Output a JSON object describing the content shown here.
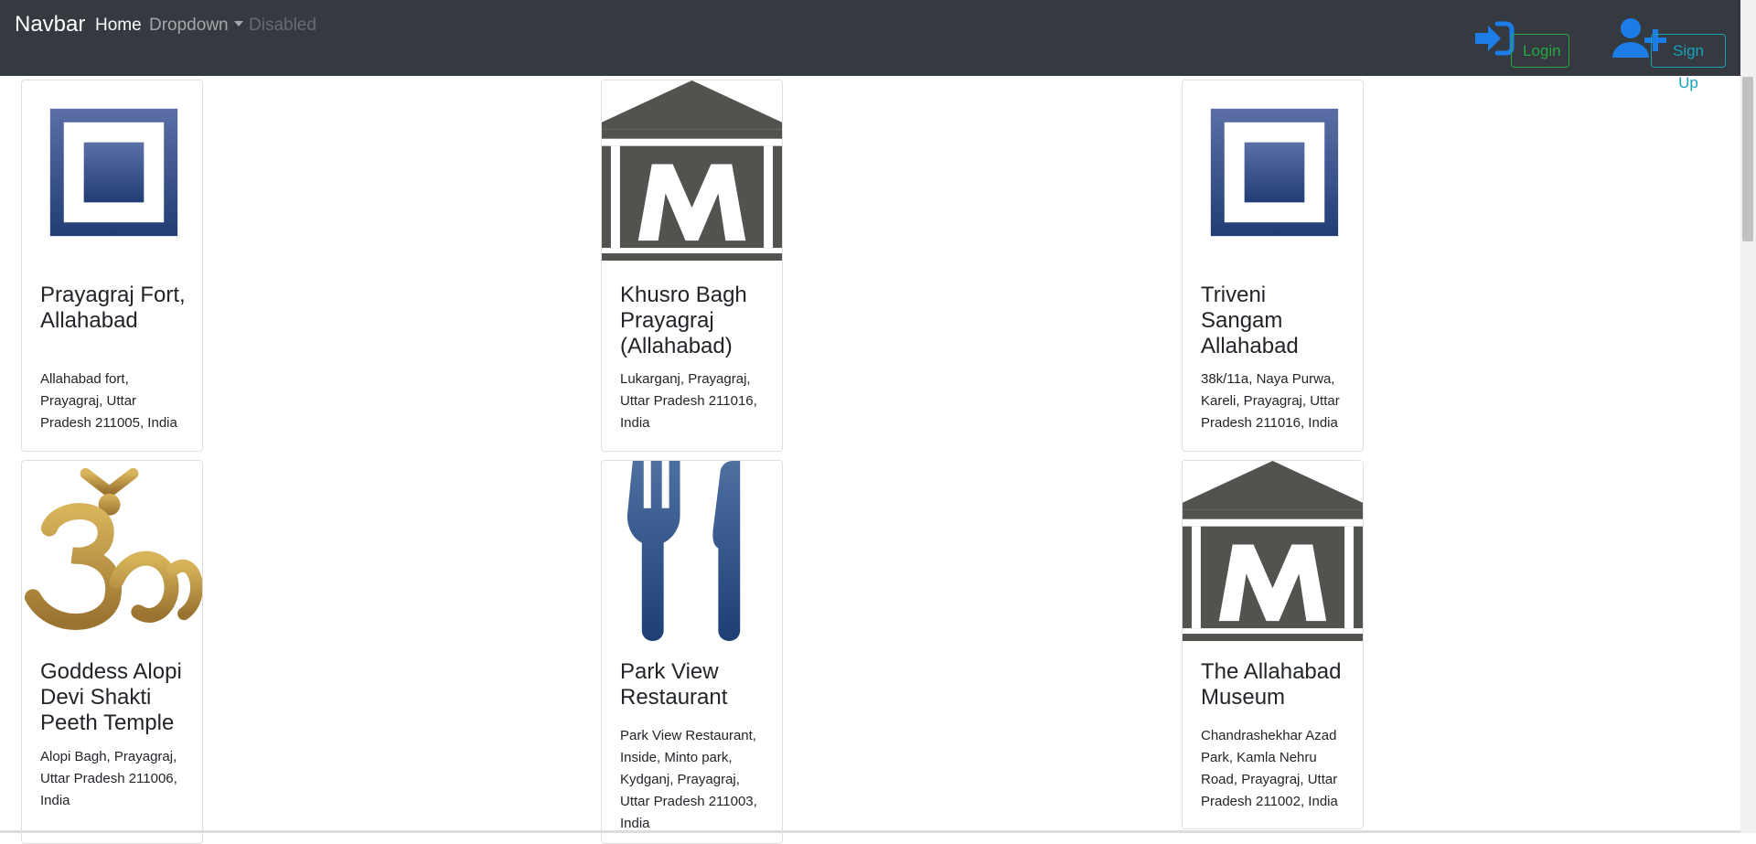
{
  "navbar": {
    "brand": "Navbar",
    "links": [
      {
        "label": "Home",
        "state": "active"
      },
      {
        "label": "Dropdown",
        "state": "dropdown"
      },
      {
        "label": "Disabled",
        "state": "disabled"
      }
    ],
    "login_label": "Login",
    "signup_label": "Sign Up",
    "colors": {
      "background": "#343a40",
      "icon": "#1c7de6",
      "login": "#28a745",
      "signup": "#17a2b8"
    }
  },
  "places": [
    {
      "title": "Prayagraj Fort, Allahabad",
      "address": "Allahabad fort, Prayagraj, Uttar Pradesh 211005, India",
      "icon": "square-landmark-icon"
    },
    {
      "title": "Khusro Bagh Prayagraj (Allahabad)",
      "address": "Lukarganj, Prayagraj, Uttar Pradesh 211016, India",
      "icon": "museum-icon"
    },
    {
      "title": "Triveni Sangam Allahabad",
      "address": "38k/11a, Naya Purwa, Kareli, Prayagraj, Uttar Pradesh 211016, India",
      "icon": "square-landmark-icon"
    },
    {
      "title": "Goddess Alopi Devi Shakti Peeth Temple",
      "address": "Alopi Bagh, Prayagraj, Uttar Pradesh 211006, India",
      "icon": "om-icon"
    },
    {
      "title": "Park View Restaurant",
      "address": "Park View Restaurant, Inside, Minto park, Kydganj, Prayagraj, Uttar Pradesh 211003, India",
      "icon": "fork-knife-icon"
    },
    {
      "title": "The Allahabad Museum",
      "address": "Chandrashekhar Azad Park, Kamla Nehru Road, Prayagraj, Uttar Pradesh 211002, India",
      "icon": "museum-icon"
    }
  ]
}
